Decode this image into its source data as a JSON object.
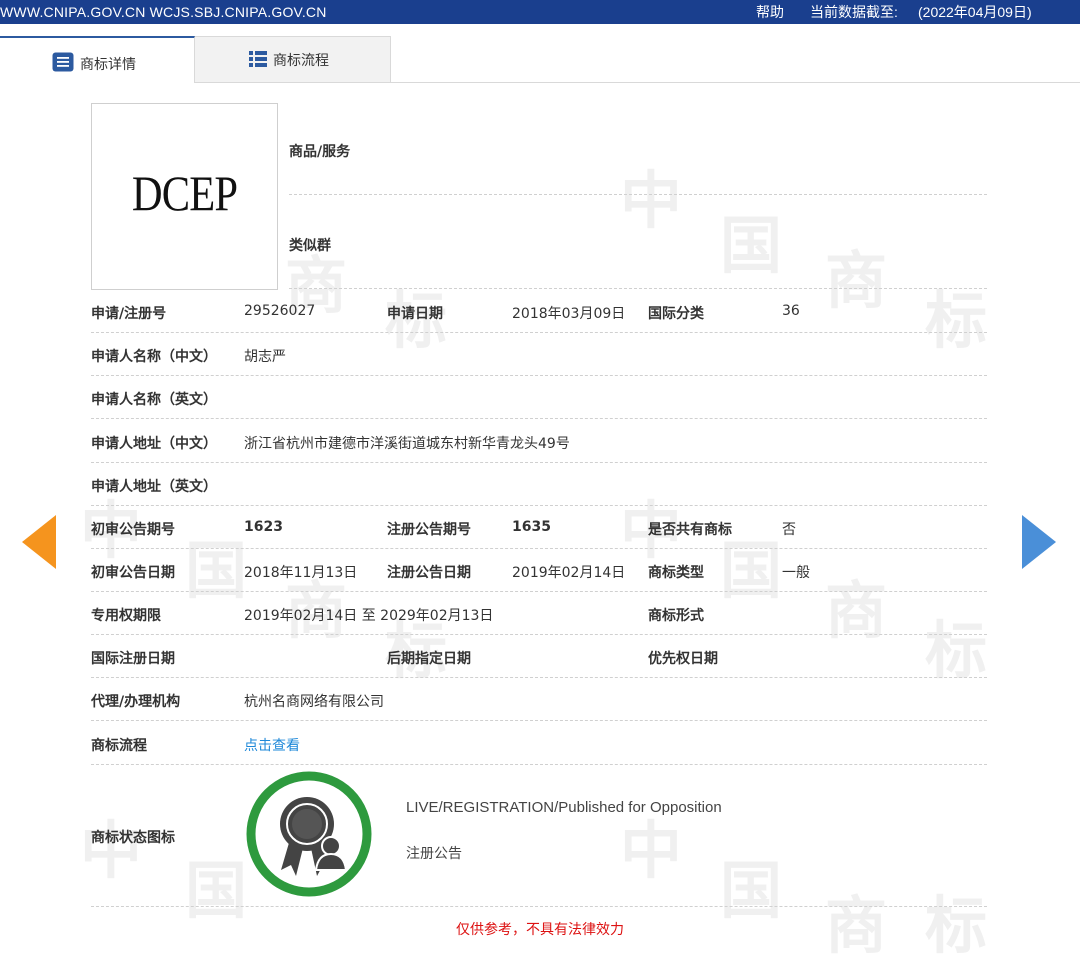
{
  "header": {
    "site": "WWW.CNIPA.GOV.CN WCJS.SBJ.CNIPA.GOV.CN",
    "help": "帮助",
    "data_label": "当前数据截至:",
    "data_date": "(2022年04月09日)"
  },
  "tabs": [
    {
      "label": "商标详情",
      "icon": "document-icon",
      "active": true
    },
    {
      "label": "商标流程",
      "icon": "list-icon",
      "active": false
    }
  ],
  "trademark": {
    "logo_text": "DCEP",
    "goods_label": "商品/服务",
    "similar_group_label": "类似群"
  },
  "details": {
    "reg_no_label": "申请/注册号",
    "reg_no": "29526027",
    "app_date_label": "申请日期",
    "app_date": "2018年03月09日",
    "intl_class_label": "国际分类",
    "intl_class": "36",
    "applicant_cn_label": "申请人名称（中文）",
    "applicant_cn": "胡志严",
    "applicant_en_label": "申请人名称（英文）",
    "applicant_en": "",
    "address_cn_label": "申请人地址（中文）",
    "address_cn": "浙江省杭州市建德市洋溪街道城东村新华青龙头49号",
    "address_en_label": "申请人地址（英文）",
    "address_en": "",
    "prelim_issue_label": "初审公告期号",
    "prelim_issue": "1623",
    "reg_issue_label": "注册公告期号",
    "reg_issue": "1635",
    "shared_label": "是否共有商标",
    "shared": "否",
    "prelim_date_label": "初审公告日期",
    "prelim_date": "2018年11月13日",
    "reg_date_label": "注册公告日期",
    "reg_date": "2019年02月14日",
    "tm_type_label": "商标类型",
    "tm_type": "一般",
    "exclusive_label": "专用权期限",
    "exclusive": "2019年02月14日 至 2029年02月13日",
    "tm_form_label": "商标形式",
    "tm_form": "",
    "intl_reg_date_label": "国际注册日期",
    "intl_reg_date": "",
    "later_date_label": "后期指定日期",
    "later_date": "",
    "priority_date_label": "优先权日期",
    "priority_date": "",
    "agent_label": "代理/办理机构",
    "agent": "杭州名商网络有限公司",
    "process_label": "商标流程",
    "process_link": "点击查看"
  },
  "status": {
    "label": "商标状态图标",
    "icon": "registration-seal-icon",
    "text_en": "LIVE/REGISTRATION/Published for Opposition",
    "text_cn": "注册公告"
  },
  "disclaimer": "仅供参考，不具有法律效力",
  "colors": {
    "header_bg": "#1a3f8e",
    "link": "#1e88d8",
    "prev_arrow": "#f5941e",
    "next_arrow": "#4a8fd8",
    "seal_ring": "#2e9a3e",
    "disclaimer": "#dd1111"
  }
}
